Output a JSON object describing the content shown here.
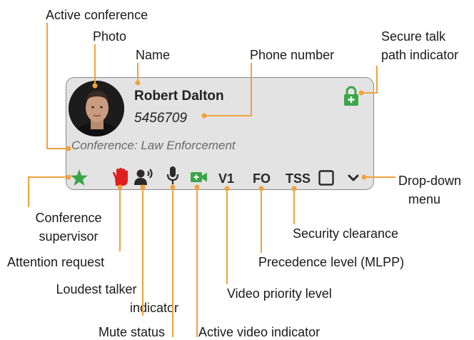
{
  "card": {
    "name": "Robert Dalton",
    "phone": "5456709",
    "conference": "Conference: Law Enforcement",
    "video_priority": "V1",
    "precedence": "FO",
    "security": "TSS"
  },
  "labels": {
    "active_conference": "Active conference",
    "photo": "Photo",
    "name": "Name",
    "phone_number": "Phone number",
    "secure_1": "Secure talk",
    "secure_2": "path indicator",
    "dropdown_1": "Drop-down",
    "dropdown_2": "menu",
    "supervisor_1": "Conference",
    "supervisor_2": "supervisor",
    "attention": "Attention request",
    "loudest_1": "Loudest talker",
    "loudest_2": "indicator",
    "mute": "Mute status",
    "active_video": "Active video indicator",
    "video_priority": "Video priority level",
    "precedence": "Precedence level (MLPP)",
    "security": "Security clearance"
  },
  "icons": {
    "supervisor": "star-icon",
    "attention": "raised-hand-icon",
    "loudest": "speaking-person-icon",
    "mute": "microphone-icon",
    "video": "video-camera-icon",
    "secure": "padlock-icon",
    "checkbox": "checkbox-icon",
    "dropdown": "chevron-down-icon"
  },
  "colors": {
    "leader": "#f0a23c",
    "card_bg": "#e3e3e3",
    "green": "#3aa64a",
    "red": "#e01e1e"
  }
}
